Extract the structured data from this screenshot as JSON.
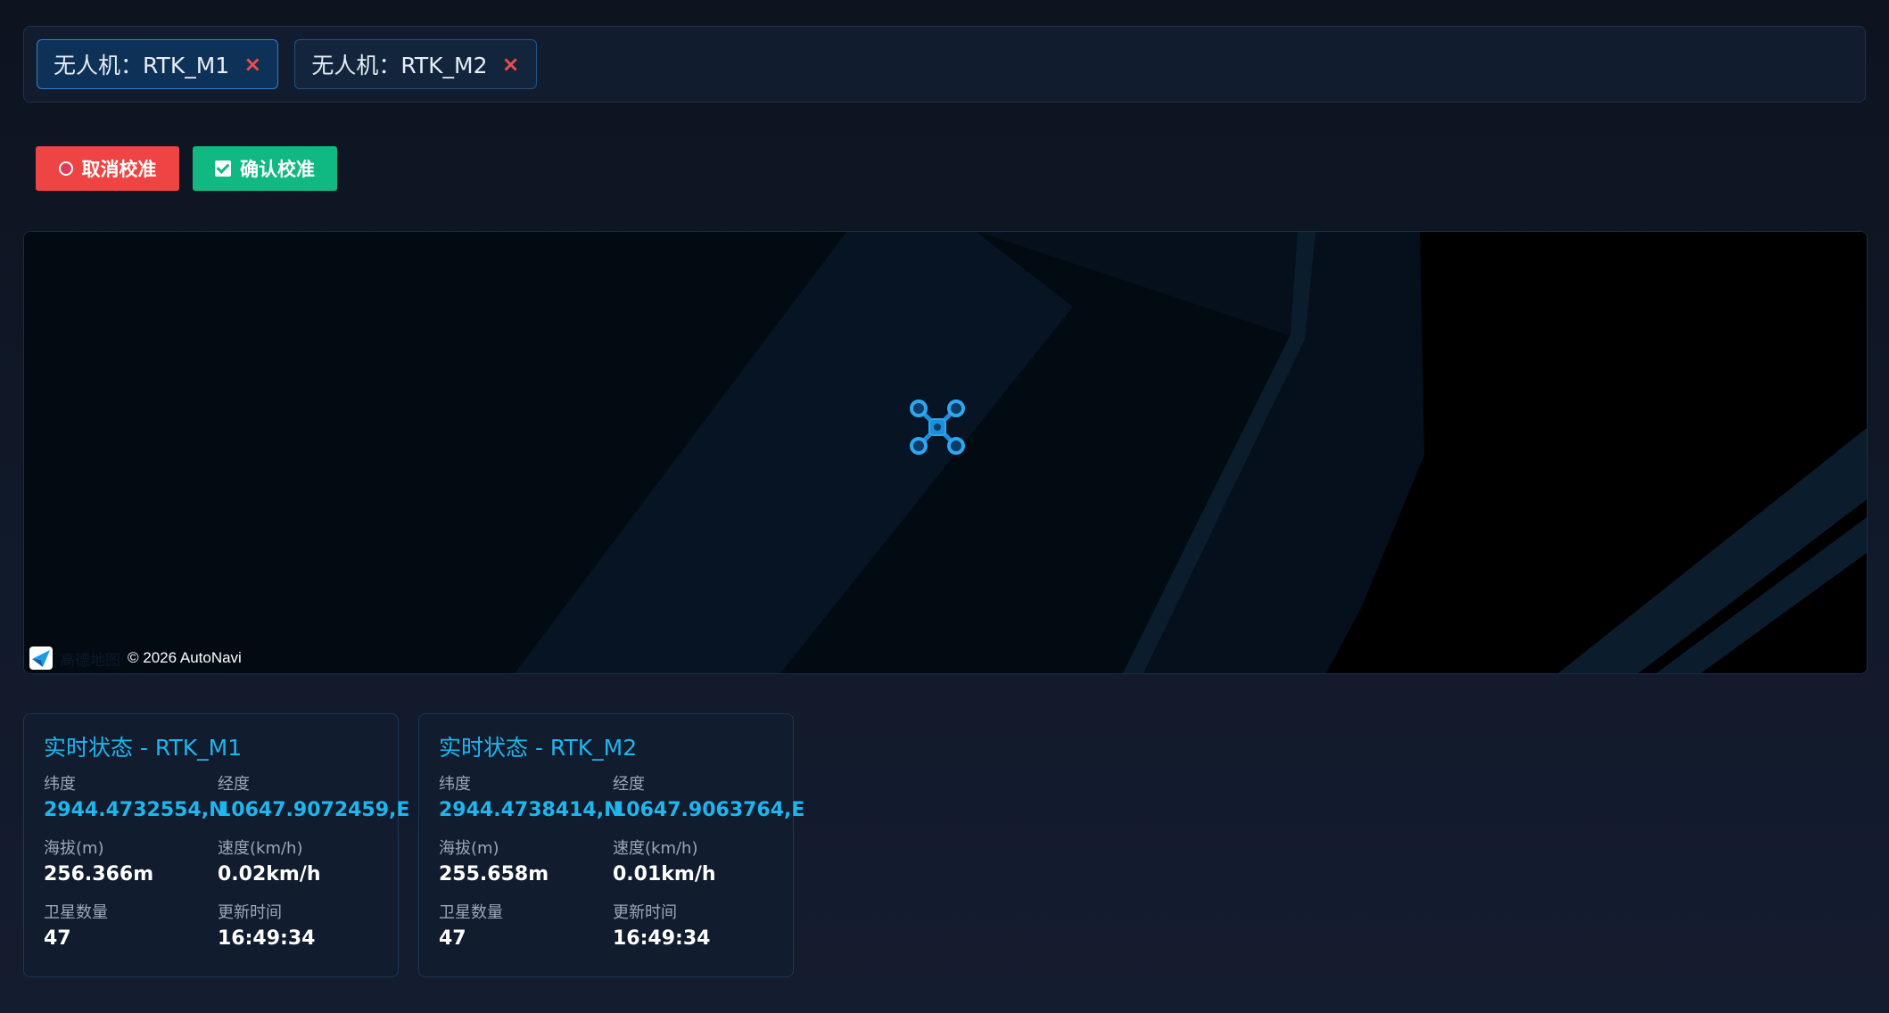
{
  "tabs": [
    {
      "label": "无人机：RTK_M1",
      "active": true
    },
    {
      "label": "无人机：RTK_M2",
      "active": false
    }
  ],
  "tab_close_glyph": "×",
  "actions": {
    "cancel_label": "取消校准",
    "confirm_label": "确认校准"
  },
  "map": {
    "attribution": "© 2026 AutoNavi",
    "logo_text": "高德地图"
  },
  "cards": [
    {
      "title": "实时状态 - RTK_M1",
      "latitude_label": "纬度",
      "latitude": "2944.4732554,N",
      "longitude_label": "经度",
      "longitude": "10647.9072459,E",
      "altitude_label": "海拔(m)",
      "altitude": "256.366m",
      "speed_label": "速度(km/h)",
      "speed": "0.02km/h",
      "satellites_label": "卫星数量",
      "satellites": "47",
      "updated_label": "更新时间",
      "updated": "16:49:34"
    },
    {
      "title": "实时状态 - RTK_M2",
      "latitude_label": "纬度",
      "latitude": "2944.4738414,N",
      "longitude_label": "经度",
      "longitude": "10647.9063764,E",
      "altitude_label": "海拔(m)",
      "altitude": "255.658m",
      "speed_label": "速度(km/h)",
      "speed": "0.01km/h",
      "satellites_label": "卫星数量",
      "satellites": "47",
      "updated_label": "更新时间",
      "updated": "16:49:34"
    }
  ],
  "colors": {
    "accent": "#1eb6ee",
    "danger": "#ef4444",
    "success": "#10b981"
  },
  "icons": {
    "cancel": "circle-icon",
    "confirm": "checkbox-icon",
    "marker": "drone-icon",
    "close": "close-icon"
  }
}
